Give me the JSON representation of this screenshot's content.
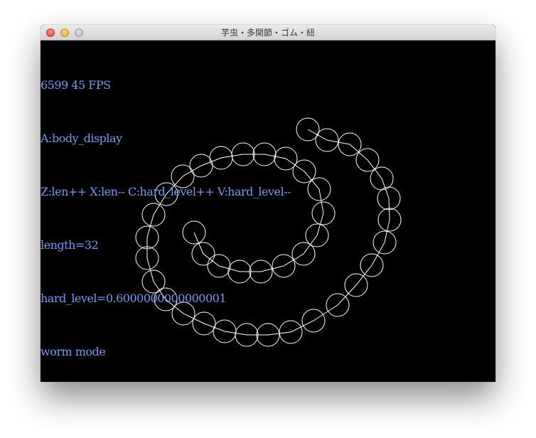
{
  "window": {
    "title": "芋虫・多関節・ゴム・紐"
  },
  "hud": {
    "fps_line": "6599 45 FPS",
    "key_a": "A:body_display",
    "keys_line": "Z:len++ X:len-- C:hard_level++ V:hard_level--",
    "length_line": "length=32",
    "hard_level_line": "hard_level=0.6000000000000001",
    "mode_line": "worm mode"
  },
  "worm": {
    "length": 32,
    "segment_color": "#ffffff",
    "background": "#000000"
  },
  "colors": {
    "hud_text": "#6e9cf5"
  }
}
